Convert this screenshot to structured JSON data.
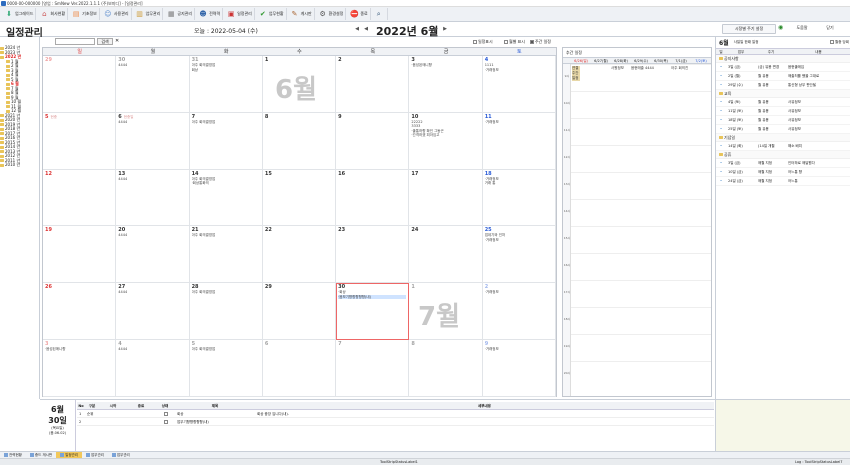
{
  "window_title": "0000-00-000000 [영업 : SmNew Ver.2022.1.1.1 (주)보미디] - [일정관리]",
  "toolbar": [
    {
      "label": "업그레이드",
      "icon": "download-icon"
    },
    {
      "label": "회사현황",
      "icon": "home-icon"
    },
    {
      "label": "기초정보",
      "icon": "database-icon"
    },
    {
      "label": "사용관리",
      "icon": "user-icon"
    },
    {
      "label": "업무관리",
      "icon": "folder-icon"
    },
    {
      "label": "공지관리",
      "icon": "note-icon"
    },
    {
      "label": "전력력",
      "icon": "person-icon"
    },
    {
      "label": "일정관리",
      "icon": "calendar-icon"
    },
    {
      "label": "업무현황",
      "icon": "check-icon"
    },
    {
      "label": "게시판",
      "icon": "board-icon"
    },
    {
      "label": "환경설정",
      "icon": "gear-icon"
    },
    {
      "label": "종료",
      "icon": "stop-icon"
    },
    {
      "label": "",
      "icon": "search-icon"
    }
  ],
  "header": {
    "title": "일정관리",
    "today_label": "오늘 : 2022-05-04 (수)",
    "month": "2022년 6월",
    "nav_prev": "◀",
    "nav_next": "▶",
    "chk_sch": "일정표시",
    "chk_mon": "월별 표시",
    "chk_week": "주간 일정",
    "btn_filter": "시정별 주기 설정",
    "btn_new": "도움말",
    "btn_close": "닫기"
  },
  "search": {
    "label": "",
    "button": "검색",
    "value": ""
  },
  "tree": [
    {
      "label": "2024 년",
      "child": false
    },
    {
      "label": "2023 년",
      "child": false
    },
    {
      "label": "2022 년",
      "child": false,
      "selected": true
    },
    {
      "label": "1 월",
      "child": true
    },
    {
      "label": "2 월",
      "child": true
    },
    {
      "label": "3 월",
      "child": true
    },
    {
      "label": "4 월",
      "child": true
    },
    {
      "label": "5 월",
      "child": true
    },
    {
      "label": "6 월",
      "child": true,
      "selected": true
    },
    {
      "label": "7 월",
      "child": true
    },
    {
      "label": "8 월",
      "child": true
    },
    {
      "label": "9 월",
      "child": true
    },
    {
      "label": "10 월",
      "child": true
    },
    {
      "label": "11 월",
      "child": true
    },
    {
      "label": "12 월",
      "child": true
    },
    {
      "label": "2021 년",
      "child": false
    },
    {
      "label": "2020 년",
      "child": false
    },
    {
      "label": "2019 년",
      "child": false
    },
    {
      "label": "2018 년",
      "child": false
    },
    {
      "label": "2017 년",
      "child": false
    },
    {
      "label": "2016 년",
      "child": false
    },
    {
      "label": "2015 년",
      "child": false
    },
    {
      "label": "2014 년",
      "child": false
    },
    {
      "label": "2013 년",
      "child": false
    },
    {
      "label": "2012 년",
      "child": false
    },
    {
      "label": "2011 년",
      "child": false
    },
    {
      "label": "2010 년",
      "child": false
    }
  ],
  "weekdays": [
    "일",
    "월",
    "화",
    "수",
    "목",
    "금",
    "토"
  ],
  "month_mark_june": "6월",
  "month_mark_july": "7월",
  "days": [
    {
      "d": "29",
      "other": true,
      "hol": "",
      "ev": []
    },
    {
      "d": "30",
      "other": true,
      "hol": "",
      "ev": [
        "4444"
      ]
    },
    {
      "d": "31",
      "other": true,
      "hol": "",
      "ev": [
        "아주 회의결영업",
        "회상"
      ]
    },
    {
      "d": "1",
      "hol": "",
      "ev": []
    },
    {
      "d": "2",
      "hol": "",
      "ev": []
    },
    {
      "d": "3",
      "hol": "",
      "ev": [
        "·음성된매니향"
      ]
    },
    {
      "d": "4",
      "hol": "",
      "ev": [
        "1111",
        "·거래정보"
      ]
    },
    {
      "d": "5",
      "hol": "현충",
      "ev": []
    },
    {
      "d": "6",
      "hol": "현충일",
      "ev": [
        "4444"
      ]
    },
    {
      "d": "7",
      "hol": "",
      "ev": [
        "아주 회의결영업"
      ]
    },
    {
      "d": "8",
      "hol": "",
      "ev": []
    },
    {
      "d": "9",
      "hol": "",
      "ev": []
    },
    {
      "d": "10",
      "hol": "",
      "ev": [
        "22222",
        "3333",
        "·출통하향 확인 그동곤",
        "·간격하겠 피아임고"
      ]
    },
    {
      "d": "11",
      "hol": "",
      "ev": [
        "·거래정보"
      ]
    },
    {
      "d": "12",
      "hol": "",
      "ev": []
    },
    {
      "d": "13",
      "hol": "",
      "ev": [
        "4444"
      ]
    },
    {
      "d": "14",
      "hol": "",
      "ev": [
        "아주 회의결영업",
        "·회상통화의"
      ]
    },
    {
      "d": "15",
      "hol": "",
      "ev": []
    },
    {
      "d": "16",
      "hol": "",
      "ev": []
    },
    {
      "d": "17",
      "hol": "",
      "ev": []
    },
    {
      "d": "18",
      "hol": "",
      "ev": [
        "·거래정보",
        "거래 통"
      ]
    },
    {
      "d": "19",
      "hol": "",
      "ev": []
    },
    {
      "d": "20",
      "hol": "",
      "ev": [
        "4444"
      ]
    },
    {
      "d": "21",
      "hol": "",
      "ev": [
        "아주 회의결영업"
      ]
    },
    {
      "d": "22",
      "hol": "",
      "ev": []
    },
    {
      "d": "23",
      "hol": "",
      "ev": []
    },
    {
      "d": "24",
      "hol": "",
      "ev": []
    },
    {
      "d": "25",
      "hol": "",
      "ev": [
        "업데기와 인처",
        "·거래정보"
      ]
    },
    {
      "d": "26",
      "hol": "",
      "ev": []
    },
    {
      "d": "27",
      "hol": "",
      "ev": [
        "4444"
      ]
    },
    {
      "d": "28",
      "hol": "",
      "ev": [
        "아주 회의결영업"
      ]
    },
    {
      "d": "29",
      "hol": "",
      "ev": []
    },
    {
      "d": "30",
      "hol": "",
      "today": true,
      "ev": [
        "·회상",
        "·음보기향향향향향(내)"
      ]
    },
    {
      "d": "1",
      "other": true,
      "hol": "",
      "ev": []
    },
    {
      "d": "2",
      "other": true,
      "hol": "",
      "ev": [
        "·거래정보"
      ]
    },
    {
      "d": "3",
      "other": true,
      "hol": "",
      "ev": [
        "·음성된매니향"
      ]
    },
    {
      "d": "4",
      "other": true,
      "hol": "",
      "ev": [
        "4444"
      ]
    },
    {
      "d": "5",
      "other": true,
      "hol": "",
      "ev": [
        "아주 회의결영업"
      ]
    },
    {
      "d": "6",
      "other": true,
      "hol": "",
      "ev": []
    },
    {
      "d": "7",
      "other": true,
      "hol": "",
      "ev": []
    },
    {
      "d": "8",
      "other": true,
      "hol": "",
      "ev": []
    },
    {
      "d": "9",
      "other": true,
      "hol": "",
      "ev": [
        "·거래정보"
      ]
    }
  ],
  "week": {
    "top": "추간 일정",
    "heads": [
      "6/26(일)",
      "6/27(월)",
      "6/28(화)",
      "6/29(수)",
      "6/30(목)",
      "7/1(금)",
      "7/2(토)"
    ],
    "hours": [
      "9시",
      "10시",
      "11시",
      "12시",
      "13시",
      "14시",
      "15시",
      "16시",
      "17시",
      "18시",
      "19시",
      "20시"
    ],
    "events": [
      "연결 주간일정",
      "사원정보",
      "음현매출 4444",
      "아주 회의진"
    ]
  },
  "right": {
    "title": "6월",
    "subtitle": "사일일 한때 일정",
    "cols": [
      "일",
      "업무",
      "주기",
      "내용"
    ],
    "groups": [
      {
        "name": "공지사항",
        "rows": [
          [
            "3일 (금)",
            "(금) 유용 변경",
            "음현출매입"
          ],
          [
            "2일 (월)",
            "월 유용",
            "매출처를 했을 그대로"
          ],
          [
            "29일 (수)",
            "월 유용",
            "통신형 상무 판단될"
          ]
        ]
      },
      {
        "name": "교육",
        "rows": [
          [
            "4일 (토)",
            "월 유용",
            "사유정보"
          ],
          [
            "11일 (토)",
            "월 유용",
            "사유정보"
          ],
          [
            "18일 (토)",
            "월 유용",
            "사유정보"
          ],
          [
            "25일 (토)",
            "월 유용",
            "사유정보"
          ]
        ]
      },
      {
        "name": "기념일",
        "rows": [
          [
            "14일 (화)",
            "(14일 개월",
            "해소 배치"
          ]
        ]
      },
      {
        "name": "공휴",
        "rows": [
          [
            "3일 (금)",
            "매월 지정",
            "인터하로 매달원다"
          ],
          [
            "10일 (금)",
            "매월 지정",
            "어느통 향"
          ],
          [
            "24일 (금)",
            "매월 지정",
            "어느통"
          ]
        ]
      }
    ],
    "chk_label": "월중 당회"
  },
  "bottom": {
    "month": "6월",
    "day": "30일",
    "weekday": "(목요일)",
    "lunar": "(음.06.02)",
    "headers": [
      "No",
      "구분",
      "시작",
      "종료",
      "상태",
      "제목",
      "세부내용"
    ],
    "rows": [
      [
        "1",
        "순위",
        "",
        "",
        "",
        "회상",
        "회상 중앙 입니다(내)."
      ],
      [
        "2",
        "",
        "",
        "",
        "",
        "업무기향향향향향(내)",
        ""
      ]
    ]
  },
  "tabs": [
    "전력현황",
    "중드 게시판",
    "일정관리",
    "업무관리",
    "업무관리"
  ],
  "status": {
    "left": "",
    "mid": "ToolStripStatusLabel1",
    "right": "Log : ToolStripStatusLabel7"
  }
}
